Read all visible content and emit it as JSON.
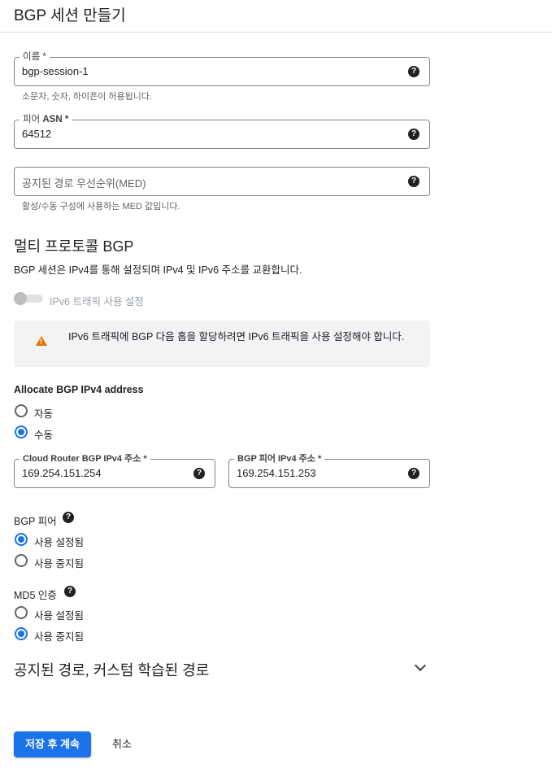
{
  "header": {
    "title": "BGP 세션 만들기"
  },
  "name_field": {
    "label": "이름",
    "required_mark": "*",
    "value": "bgp-session-1",
    "hint": "소문자, 숫자, 하이픈이 허용됩니다."
  },
  "peer_asn_field": {
    "label": "피어 ",
    "label_bold": "ASN",
    "required_mark": "*",
    "value": "64512"
  },
  "med_field": {
    "placeholder": "공지된 경로 우선순위(MED)",
    "hint": "활성/수동 구성에 사용하는 MED 값입니다."
  },
  "multiprotocol": {
    "title": "멀티 프로토콜 BGP",
    "description": "BGP 세션은 IPv4를 통해 설정되며 IPv4 및 IPv6 주소를 교환합니다.",
    "toggle_label": "IPv6 트래픽 사용 설정",
    "toggle_on": false,
    "warning": "IPv6 트래픽에 BGP 다음 홉을 할당하려면 IPv6 트래픽을 사용 설정해야 합니다."
  },
  "allocate": {
    "title": "Allocate BGP IPv4 address",
    "options": [
      "자동",
      "수동"
    ],
    "selected": "수동"
  },
  "router_ip_field": {
    "label": "Cloud Router BGP IPv4 주소 *",
    "value": "169.254.151.254"
  },
  "peer_ip_field": {
    "label": "BGP 피어 IPv4 주소 *",
    "value": "169.254.151.253"
  },
  "bgp_peer": {
    "title": "BGP 피어",
    "options": [
      "사용 설정됨",
      "사용 중지됨"
    ],
    "selected": "사용 설정됨"
  },
  "md5": {
    "title": "MD5 인증",
    "options": [
      "사용 설정됨",
      "사용 중지됨"
    ],
    "selected": "사용 중지됨"
  },
  "routes_section": {
    "title": "공지된 경로, 커스텀 학습된 경로"
  },
  "actions": {
    "save_label": "저장 후 계속",
    "cancel_label": "취소"
  },
  "icons": {
    "help": "help-icon",
    "warning": "warning-icon",
    "expand": "chevron-down-icon"
  },
  "colors": {
    "accent": "#1a73e8",
    "warning": "#e37400",
    "border": "#80868b"
  }
}
